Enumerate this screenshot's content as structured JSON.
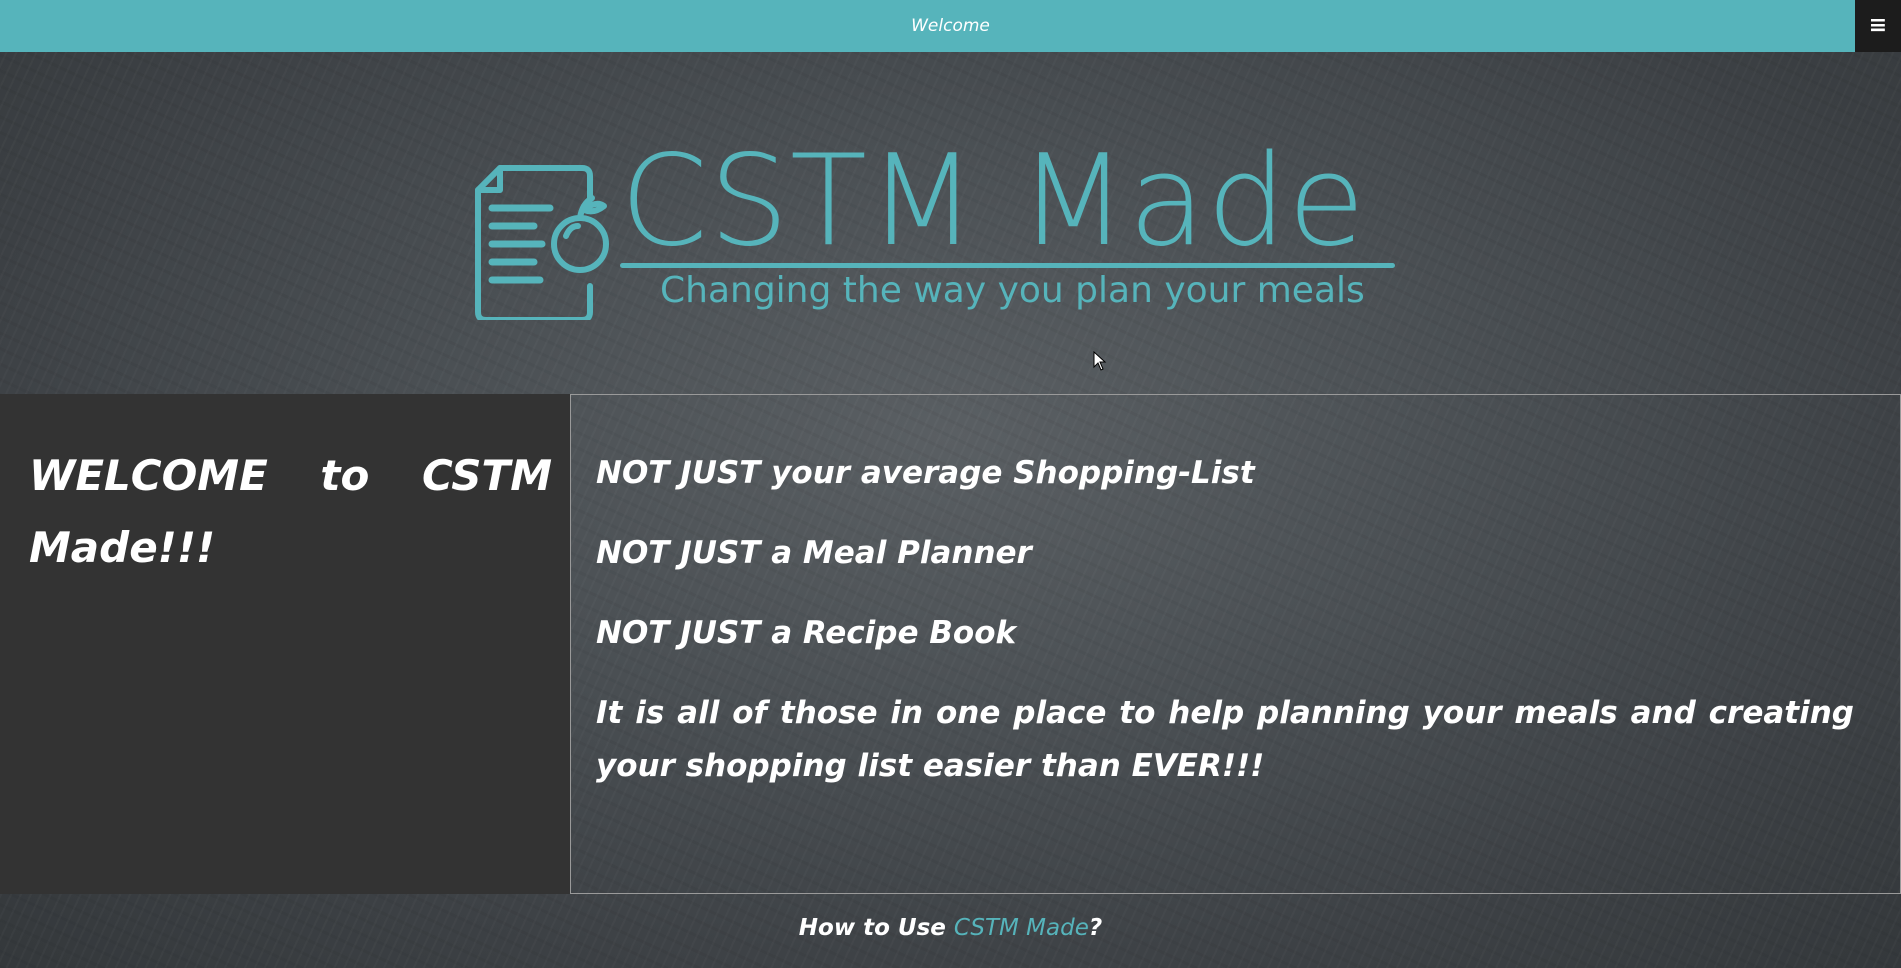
{
  "header": {
    "title": "Welcome",
    "menu_icon": "hamburger-menu-icon"
  },
  "logo": {
    "title": "CSTM Made",
    "tagline": "Changing the way you plan your meals",
    "icon": "recipe-document-apple-icon"
  },
  "intro": {
    "heading": "WELCOME to CSTM Made!!!",
    "features": [
      "NOT JUST your average Shopping-List",
      "NOT JUST a Meal Planner",
      "NOT JUST a Recipe Book",
      "It is all of those in one place to help planning your meals and creating your shopping list easier than EVER!!!"
    ]
  },
  "howto": {
    "prefix": "How to Use ",
    "brand": "CSTM Made",
    "suffix": "?"
  },
  "colors": {
    "accent": "#56b4bb",
    "panel": "#333333",
    "menu_button": "#1c1c1c"
  }
}
